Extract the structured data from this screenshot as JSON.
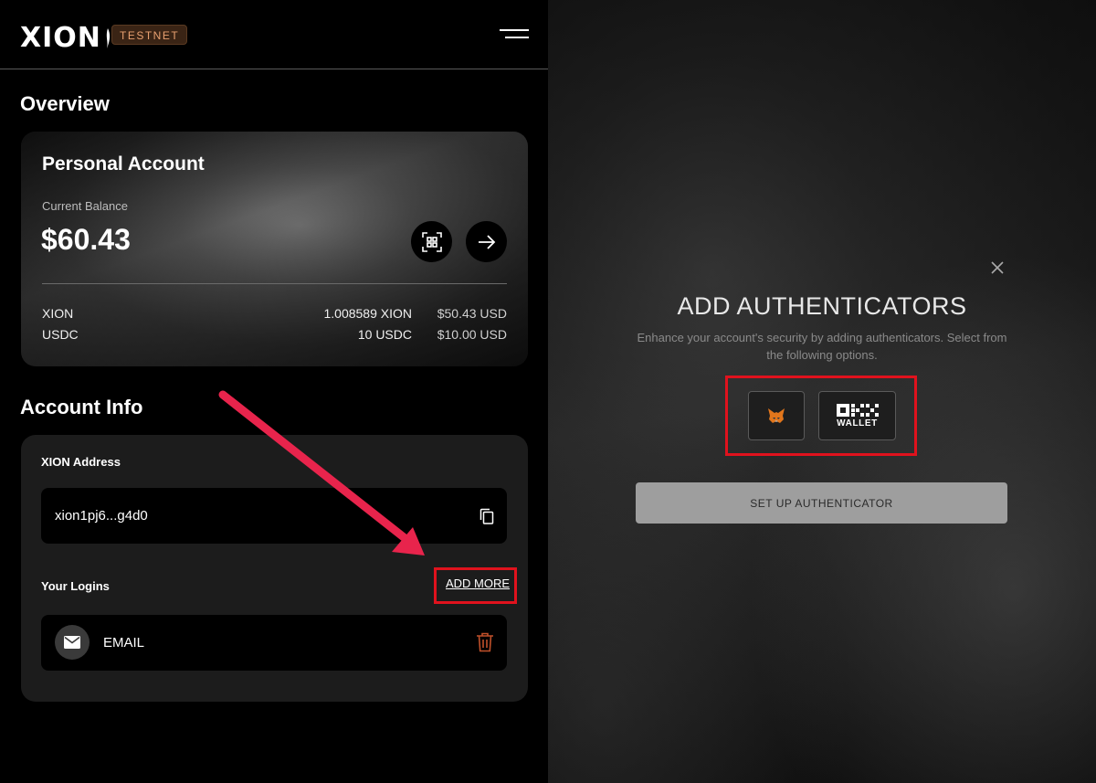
{
  "header": {
    "logo": "XION",
    "badge": "TESTNET"
  },
  "overview": {
    "title": "Overview",
    "card_title": "Personal Account",
    "balance_label": "Current Balance",
    "balance_value": "$60.43",
    "assets": [
      {
        "name": "XION",
        "quantity": "1.008589 XION",
        "usd": "$50.43 USD"
      },
      {
        "name": "USDC",
        "quantity": "10 USDC",
        "usd": "$10.00 USD"
      }
    ]
  },
  "account_info": {
    "title": "Account Info",
    "address_label": "XION Address",
    "address_value": "xion1pj6...g4d0",
    "logins_label": "Your Logins",
    "add_more_label": "ADD MORE",
    "logins": [
      {
        "method": "EMAIL"
      }
    ]
  },
  "modal": {
    "title": "ADD AUTHENTICATORS",
    "description": "Enhance your account's security by adding authenticators. Select from the following options.",
    "options": [
      {
        "name": "metamask",
        "icon": "metamask-fox-icon"
      },
      {
        "name": "okx-wallet",
        "label": "WALLET",
        "icon": "okx-logo-icon"
      }
    ],
    "setup_button": "SET UP AUTHENTICATOR"
  },
  "colors": {
    "highlight": "#e0121d",
    "arrow": "#e8244c",
    "badge_text": "#e8a070",
    "trash": "#c0502a"
  }
}
